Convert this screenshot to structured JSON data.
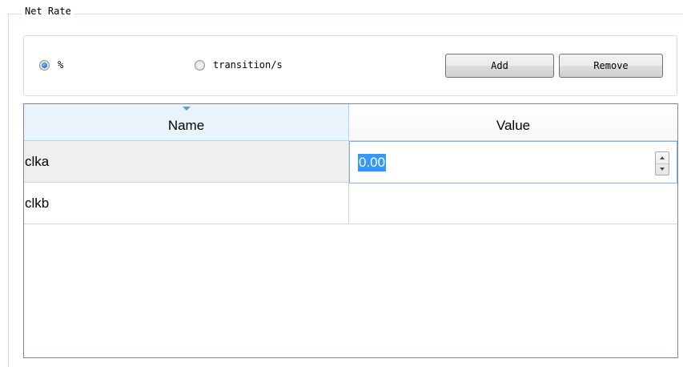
{
  "group": {
    "title": "Net Rate"
  },
  "options": {
    "radio_percent": {
      "label": "%",
      "checked": true
    },
    "radio_transition": {
      "label": "transition/s",
      "checked": false
    },
    "add_label": "Add",
    "remove_label": "Remove"
  },
  "table": {
    "columns": [
      "Name",
      "Value"
    ],
    "sorted_column": "Name",
    "rows": [
      {
        "name": "clka",
        "value": "0.00"
      },
      {
        "name": "clkb",
        "value": ""
      }
    ]
  },
  "colors": {
    "selection": "#3399ff",
    "header_active": "#e8f3fc",
    "border": "#828790"
  }
}
